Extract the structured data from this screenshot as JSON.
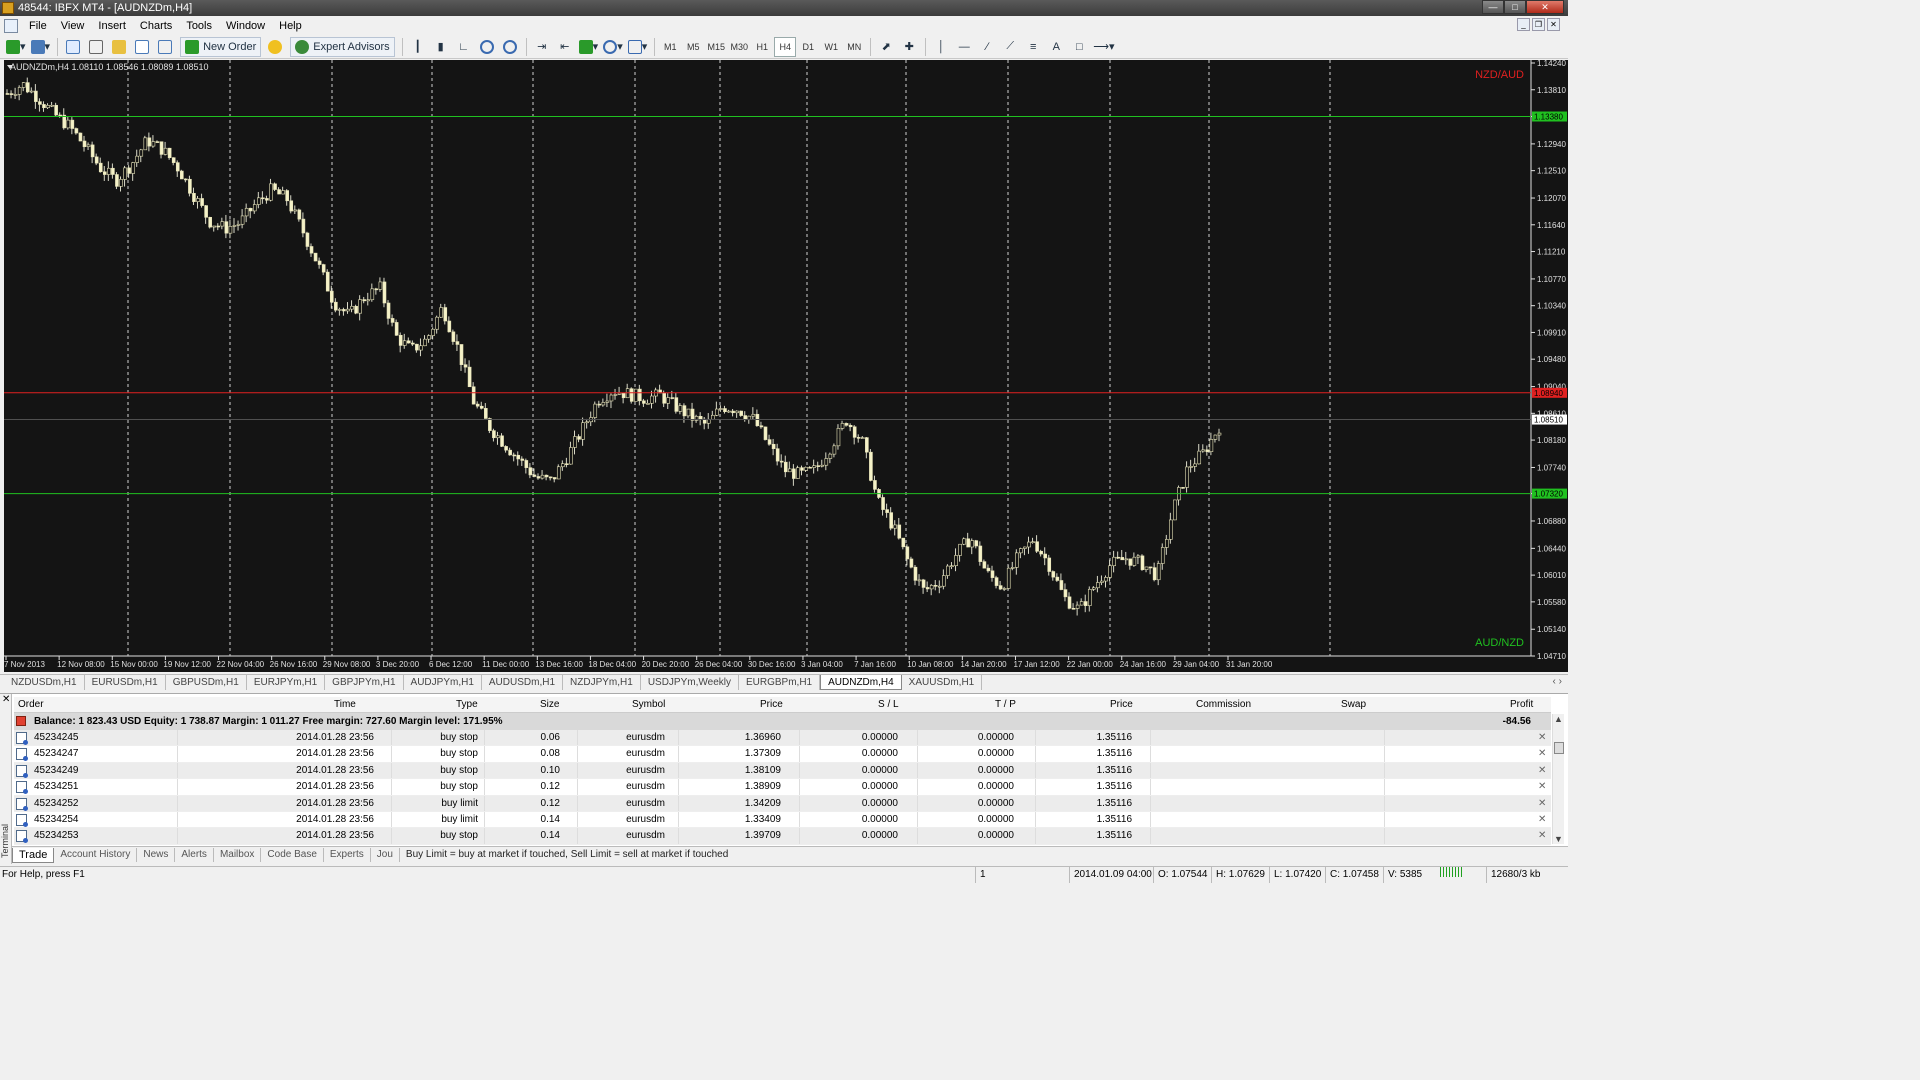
{
  "window": {
    "title": "48544: IBFX MT4 - [AUDNZDm,H4]"
  },
  "menu": [
    "File",
    "View",
    "Insert",
    "Charts",
    "Tools",
    "Window",
    "Help"
  ],
  "toolbar": {
    "new_order": "New Order",
    "expert_advisors": "Expert Advisors",
    "timeframes": [
      "M1",
      "M5",
      "M15",
      "M30",
      "H1",
      "H4",
      "D1",
      "W1",
      "MN"
    ],
    "active_timeframe": "H4",
    "text_tool": "A"
  },
  "chart": {
    "header": "AUDNZDm,H4  1.08110 1.08546 1.08089 1.08510",
    "corner_top": "NZD/AUD",
    "corner_top_color": "#e02020",
    "corner_bottom": "AUD/NZD",
    "corner_bottom_color": "#20c020"
  },
  "chart_data": {
    "type": "candlestick",
    "symbol": "AUDNZDm",
    "timeframe": "H4",
    "ylim": [
      1.0471,
      1.1424
    ],
    "y_ticks": [
      "1.14240",
      "1.13810",
      "1.13380",
      "1.12940",
      "1.12510",
      "1.12070",
      "1.11640",
      "1.11210",
      "1.10770",
      "1.10340",
      "1.09910",
      "1.09480",
      "1.09040",
      "1.08610",
      "1.08180",
      "1.07740",
      "1.07320",
      "1.06880",
      "1.06440",
      "1.06010",
      "1.05580",
      "1.05140",
      "1.04710"
    ],
    "x_ticks": [
      "7 Nov 2013",
      "12 Nov 08:00",
      "15 Nov 00:00",
      "19 Nov 12:00",
      "22 Nov 04:00",
      "26 Nov 16:00",
      "29 Nov 08:00",
      "3 Dec 20:00",
      "6 Dec 12:00",
      "11 Dec 00:00",
      "13 Dec 16:00",
      "18 Dec 04:00",
      "20 Dec 20:00",
      "26 Dec 04:00",
      "30 Dec 16:00",
      "3 Jan 04:00",
      "7 Jan 16:00",
      "10 Jan 08:00",
      "14 Jan 20:00",
      "17 Jan 12:00",
      "22 Jan 00:00",
      "24 Jan 16:00",
      "29 Jan 04:00",
      "31 Jan 20:00"
    ],
    "horizontal_lines": [
      {
        "price": 1.1338,
        "color": "#20c020",
        "label": "1.13380"
      },
      {
        "price": 1.0894,
        "color": "#e02020",
        "label": "1.08940"
      },
      {
        "price": 1.0732,
        "color": "#20c020",
        "label": "1.07320"
      }
    ],
    "current_price": "1.08510",
    "price_path": [
      1.1375,
      1.139,
      1.1368,
      1.1342,
      1.1322,
      1.129,
      1.1255,
      1.1235,
      1.1262,
      1.13,
      1.1285,
      1.1255,
      1.1212,
      1.117,
      1.1158,
      1.1168,
      1.1198,
      1.122,
      1.1205,
      1.1155,
      1.11,
      1.104,
      1.1018,
      1.1048,
      1.1062,
      1.0985,
      1.0962,
      1.098,
      1.1032,
      1.0965,
      1.088,
      1.084,
      1.0812,
      1.0785,
      1.0758,
      1.0752,
      1.079,
      1.0835,
      1.0882,
      1.0898,
      1.0892,
      1.0885,
      1.089,
      1.0872,
      1.0855,
      1.0842,
      1.0872,
      1.0868,
      1.0852,
      1.081,
      1.077,
      1.0762,
      1.077,
      1.0808,
      1.085,
      1.0818,
      1.072,
      1.068,
      1.062,
      1.0575,
      1.0592,
      1.0632,
      1.0662,
      1.0605,
      1.0582,
      1.0628,
      1.0658,
      1.062,
      1.0565,
      1.0545,
      1.0585,
      1.0618,
      1.0628,
      1.062,
      1.06,
      1.0705,
      1.0775,
      1.0798,
      1.084
    ]
  },
  "symbol_tabs": [
    "NZDUSDm,H1",
    "EURUSDm,H1",
    "GBPUSDm,H1",
    "EURJPYm,H1",
    "GBPJPYm,H1",
    "AUDJPYm,H1",
    "AUDUSDm,H1",
    "NZDJPYm,H1",
    "USDJPYm,Weekly",
    "EURGBPm,H1",
    "AUDNZDm,H4",
    "XAUUSDm,H1"
  ],
  "active_symbol_tab": "AUDNZDm,H4",
  "terminal": {
    "side_label": "Terminal",
    "columns": {
      "order": "Order",
      "time": "Time",
      "type": "Type",
      "size": "Size",
      "symbol": "Symbol",
      "price": "Price",
      "sl": "S / L",
      "tp": "T / P",
      "price2": "Price",
      "commission": "Commission",
      "swap": "Swap",
      "profit": "Profit"
    },
    "balance_line": "Balance: 1 823.43 USD  Equity: 1 738.87  Margin: 1 011.27  Free margin: 727.60  Margin level: 171.95%",
    "balance_profit": "-84.56",
    "rows": [
      {
        "order": "45234245",
        "time": "2014.01.28 23:56",
        "type": "buy stop",
        "size": "0.06",
        "symbol": "eurusdm",
        "price": "1.36960",
        "sl": "0.00000",
        "tp": "0.00000",
        "price2": "1.35116"
      },
      {
        "order": "45234247",
        "time": "2014.01.28 23:56",
        "type": "buy stop",
        "size": "0.08",
        "symbol": "eurusdm",
        "price": "1.37309",
        "sl": "0.00000",
        "tp": "0.00000",
        "price2": "1.35116"
      },
      {
        "order": "45234249",
        "time": "2014.01.28 23:56",
        "type": "buy stop",
        "size": "0.10",
        "symbol": "eurusdm",
        "price": "1.38109",
        "sl": "0.00000",
        "tp": "0.00000",
        "price2": "1.35116"
      },
      {
        "order": "45234251",
        "time": "2014.01.28 23:56",
        "type": "buy stop",
        "size": "0.12",
        "symbol": "eurusdm",
        "price": "1.38909",
        "sl": "0.00000",
        "tp": "0.00000",
        "price2": "1.35116"
      },
      {
        "order": "45234252",
        "time": "2014.01.28 23:56",
        "type": "buy limit",
        "size": "0.12",
        "symbol": "eurusdm",
        "price": "1.34209",
        "sl": "0.00000",
        "tp": "0.00000",
        "price2": "1.35116"
      },
      {
        "order": "45234254",
        "time": "2014.01.28 23:56",
        "type": "buy limit",
        "size": "0.14",
        "symbol": "eurusdm",
        "price": "1.33409",
        "sl": "0.00000",
        "tp": "0.00000",
        "price2": "1.35116"
      },
      {
        "order": "45234253",
        "time": "2014.01.28 23:56",
        "type": "buy stop",
        "size": "0.14",
        "symbol": "eurusdm",
        "price": "1.39709",
        "sl": "0.00000",
        "tp": "0.00000",
        "price2": "1.35116"
      }
    ],
    "tabs": [
      "Trade",
      "Account History",
      "News",
      "Alerts",
      "Mailbox",
      "Code Base",
      "Experts",
      "Jou"
    ],
    "active_tab": "Trade",
    "hint": "Buy Limit = buy at market if touched, Sell Limit = sell at market if touched"
  },
  "status": {
    "help": "For Help, press F1",
    "profile": "1",
    "datetime": "2014.01.09 04:00",
    "open": "O: 1.07544",
    "high": "H: 1.07629",
    "low": "L: 1.07420",
    "close": "C: 1.07458",
    "volume": "V: 5385",
    "traffic": "12680/3 kb"
  }
}
